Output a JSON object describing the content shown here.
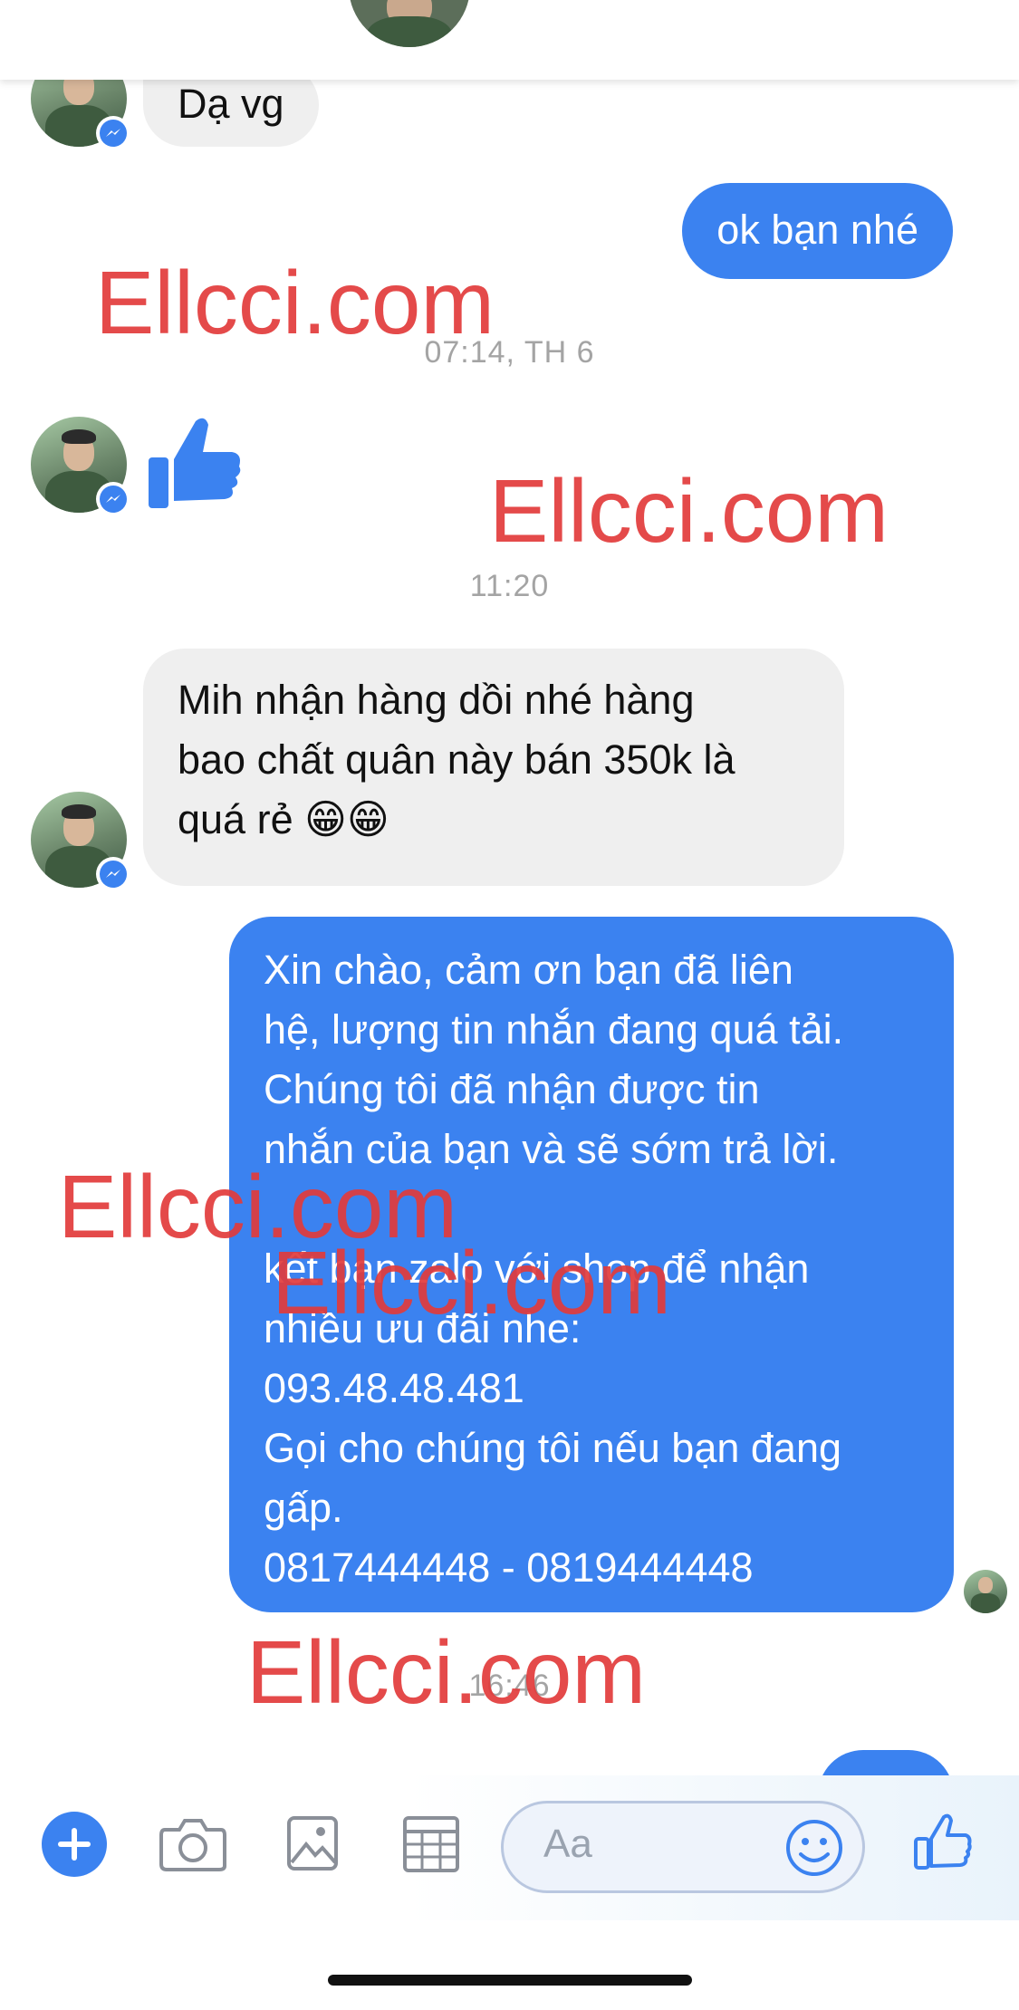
{
  "messages": {
    "m1": "Dạ vg",
    "m2": "ok bạn nhé",
    "m3_lines": [
      "Mih nhận hàng dồi nhé hàng",
      "bao chất quân này bán 350k là",
      "quá rẻ 😁😁"
    ],
    "m4_lines": [
      "Xin chào, cảm ơn bạn đã liên",
      "hệ, lượng tin nhắn đang quá tải.",
      "Chúng tôi đã nhận được tin",
      "nhắn của bạn và sẽ sớm trả lời.",
      "",
      "kết bạn zalo với shop để nhận",
      "nhiều ưu đãi nhe:",
      "093.48.48.481",
      "Gọi cho chúng tôi nếu bạn đang",
      "gấp.",
      "0817444448 - 0819444448"
    ]
  },
  "timestamps": {
    "t1": "07:14, TH 6",
    "t2": "11:20",
    "t3": "16:46"
  },
  "watermark": "Ellcci.com",
  "composer": {
    "placeholder": "Aa"
  },
  "colors": {
    "accent": "#3b82f0",
    "incoming_bubble": "#efefef",
    "watermark": "#e23b3b"
  },
  "icons": [
    "plus-icon",
    "camera-icon",
    "image-icon",
    "grid-icon",
    "smiley-icon",
    "thumbs-up-icon"
  ]
}
